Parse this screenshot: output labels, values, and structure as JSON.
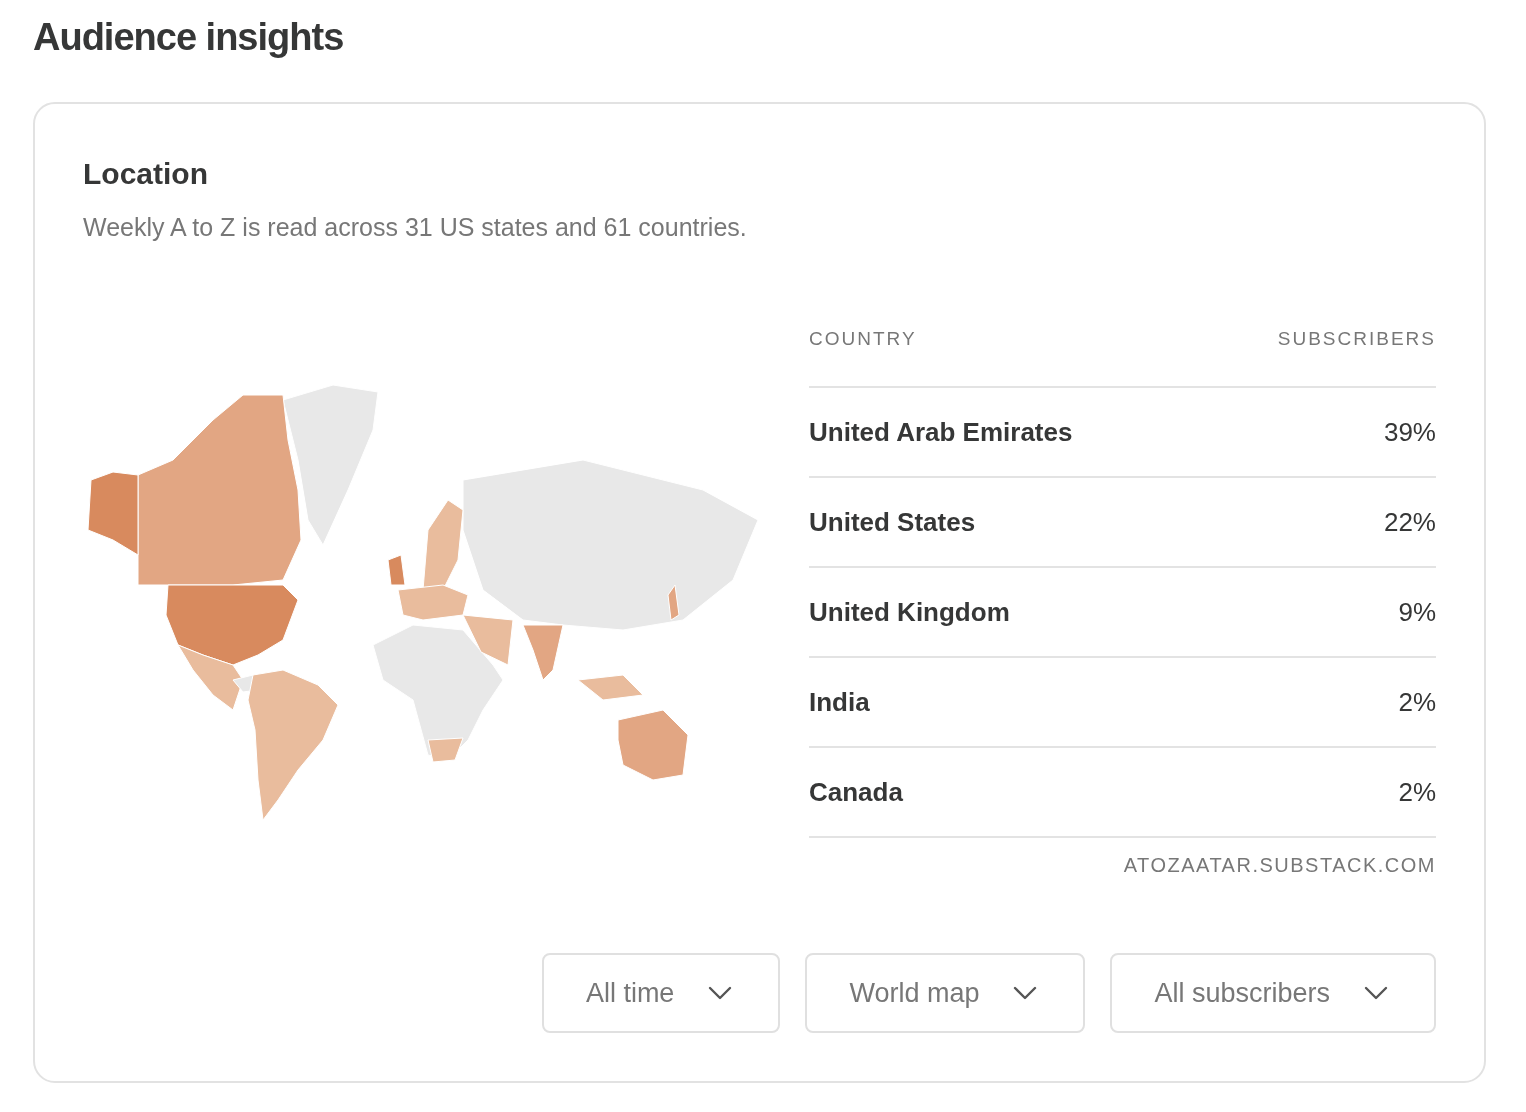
{
  "page_title": "Audience insights",
  "location": {
    "title": "Location",
    "description": "Weekly A to Z is read across 31 US states and 61 countries."
  },
  "table": {
    "columns": [
      "COUNTRY",
      "SUBSCRIBERS"
    ],
    "rows": [
      {
        "country": "United Arab Emirates",
        "share": "39%"
      },
      {
        "country": "United States",
        "share": "22%"
      },
      {
        "country": "United Kingdom",
        "share": "9%"
      },
      {
        "country": "India",
        "share": "2%"
      },
      {
        "country": "Canada",
        "share": "2%"
      }
    ]
  },
  "source": "ATOZAATAR.SUBSTACK.COM",
  "filters": [
    {
      "label": "All time"
    },
    {
      "label": "World map"
    },
    {
      "label": "All subscribers"
    }
  ]
}
